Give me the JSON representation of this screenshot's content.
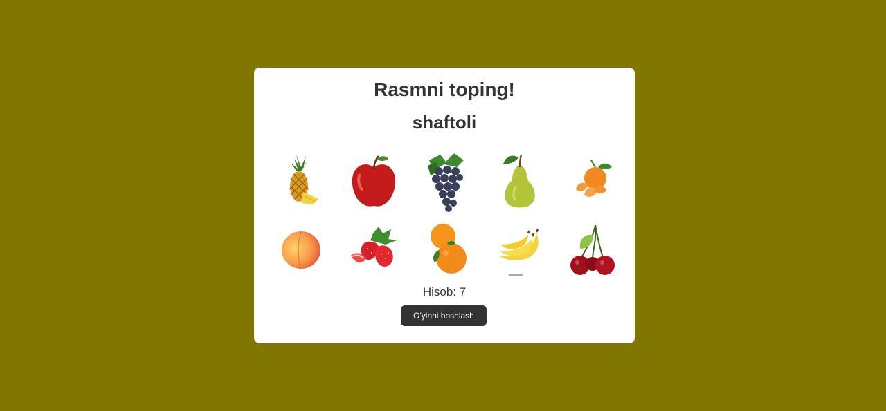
{
  "game": {
    "title": "Rasmni toping!",
    "target_word": "shaftoli",
    "score_label": "Hisob: 7",
    "start_button_label": "O'yinni boshlash"
  },
  "colors": {
    "background": "#807600",
    "card": "#ffffff",
    "text": "#333333",
    "button": "#333333"
  },
  "tiles": [
    {
      "icon": "pineapple-icon"
    },
    {
      "icon": "apple-icon"
    },
    {
      "icon": "grapes-icon"
    },
    {
      "icon": "pear-icon"
    },
    {
      "icon": "tangerine-icon"
    },
    {
      "icon": "peach-icon"
    },
    {
      "icon": "strawberry-icon"
    },
    {
      "icon": "orange-icon"
    },
    {
      "icon": "banana-icon"
    },
    {
      "icon": "cherry-icon"
    }
  ]
}
